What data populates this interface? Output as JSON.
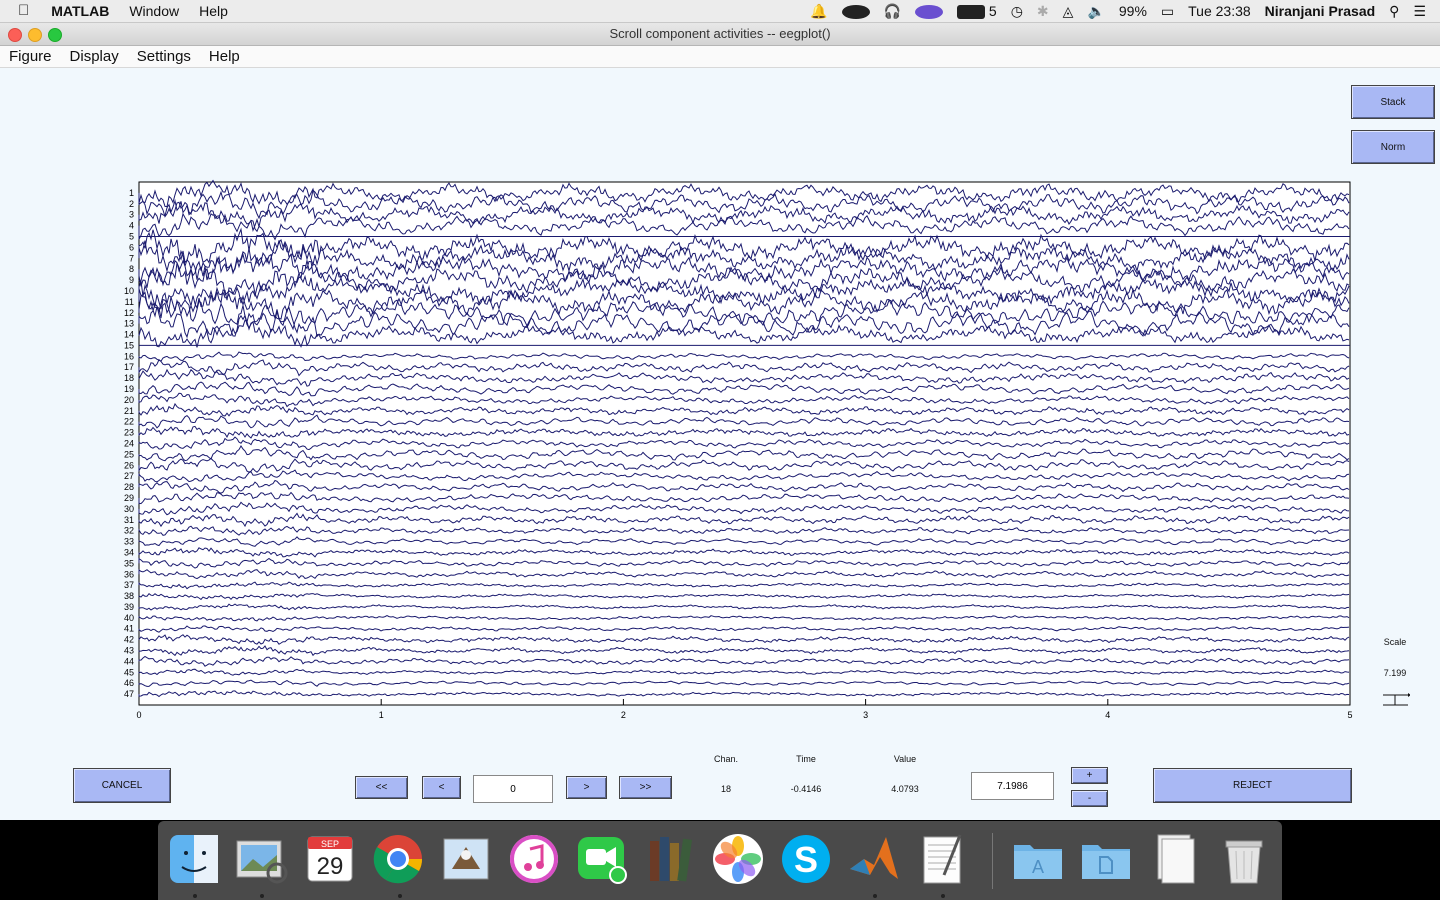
{
  "menubar": {
    "apple": "",
    "app_name": "MATLAB",
    "items": [
      "Window",
      "Help"
    ],
    "status_number": "5",
    "battery": "99%",
    "clock": "Tue 23:38",
    "user": "Niranjani Prasad"
  },
  "window": {
    "title": "Scroll component activities -- eegplot()",
    "menu": [
      "Figure",
      "Display",
      "Settings",
      "Help"
    ]
  },
  "controls": {
    "stack": "Stack",
    "norm": "Norm",
    "scale_label": "Scale",
    "scale_value": "7.199",
    "cancel": "CANCEL",
    "first": "<<",
    "prev": "<",
    "position_value": "0",
    "next": ">",
    "last": ">>",
    "chan_label": "Chan.",
    "time_label": "Time",
    "value_label": "Value",
    "chan_value": "18",
    "time_value": "-0.4146",
    "value_value": "4.0793",
    "scale_input_value": "7.1986",
    "plus": "+",
    "minus": "-",
    "reject": "REJECT"
  },
  "chart_data": {
    "type": "line",
    "title": "",
    "xlabel": "",
    "ylabel": "",
    "xlim": [
      0,
      5
    ],
    "x_ticks": [
      "0",
      "1",
      "2",
      "3",
      "4",
      "5"
    ],
    "channels": [
      "1",
      "2",
      "3",
      "4",
      "5",
      "6",
      "7",
      "8",
      "9",
      "10",
      "11",
      "12",
      "13",
      "14",
      "15",
      "16",
      "17",
      "18",
      "19",
      "20",
      "21",
      "22",
      "23",
      "24",
      "25",
      "26",
      "27",
      "28",
      "29",
      "30",
      "31",
      "32",
      "33",
      "34",
      "35",
      "36",
      "37",
      "38",
      "39",
      "40",
      "41",
      "42",
      "43",
      "44",
      "45",
      "46",
      "47"
    ],
    "channel_amplitude": [
      9,
      9,
      9,
      9,
      0,
      12,
      12,
      12,
      12,
      12,
      12,
      12,
      12,
      9,
      0,
      3,
      5,
      5,
      5,
      4,
      4,
      4,
      4,
      4,
      5,
      5,
      4,
      4,
      4,
      4,
      4,
      3,
      3,
      3,
      3,
      3,
      2,
      2,
      2,
      2,
      2,
      3,
      3,
      3,
      2,
      2,
      2
    ],
    "trace_color": "#1a1a6e",
    "grid": false
  },
  "dock": {
    "calendar_month": "SEP",
    "calendar_day": "29",
    "icons": [
      "finder-icon",
      "preview-icon",
      "calendar-icon",
      "chrome-icon",
      "mail-icon",
      "itunes-icon",
      "facetime-icon",
      "ibooks-icon",
      "photos-icon",
      "skype-icon",
      "matlab-icon",
      "textedit-icon",
      "applications-folder-icon",
      "documents-folder-icon",
      "downloads-stack-icon",
      "trash-icon"
    ]
  }
}
